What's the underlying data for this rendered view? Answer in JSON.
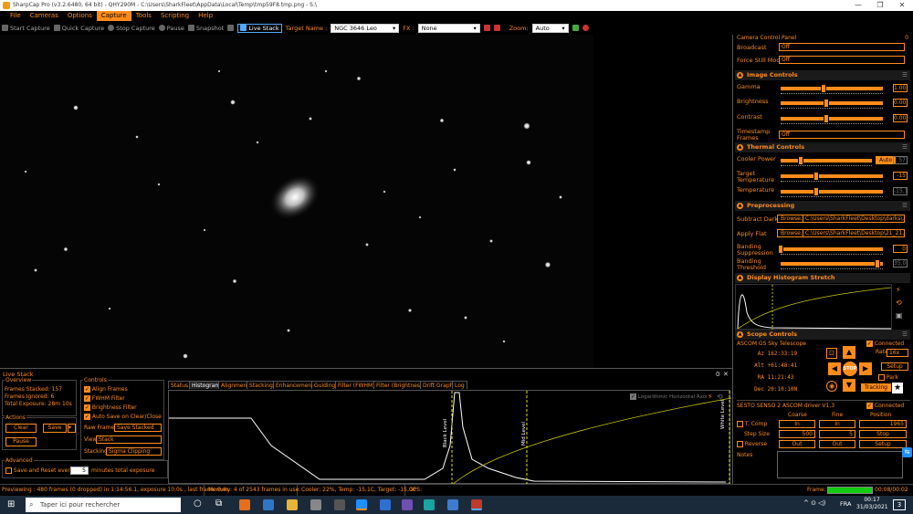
{
  "window": {
    "title": "SharpCap Pro (v3.2.6480, 64 bit) - QHY290M - C:\\Users\\SharkFleet\\AppData\\Local\\Temp\\tmp59F8.tmp.png - S:\\",
    "minimize": "—",
    "maximize": "❐",
    "close": "✕"
  },
  "menu": {
    "items": [
      "File",
      "Cameras",
      "Options",
      "Capture",
      "Tools",
      "Scripting",
      "Help"
    ],
    "active_index": 3
  },
  "toolbar": {
    "start_capture": "Start Capture",
    "quick_capture": "Quick Capture",
    "stop_capture": "Stop Capture",
    "pause": "Pause",
    "snapshot": "Snapshot",
    "live_stack": "Live Stack",
    "target_name_label": "Target Name :",
    "target_name_value": "NGC 3646 Leo",
    "fx_label": "FX :",
    "fx_value": "None",
    "zoom_label": "Zoom:",
    "zoom_value": "Auto"
  },
  "camera_panel": {
    "title": "Camera Control Panel",
    "pin": "0",
    "broadcast_label": "Broadcast",
    "broadcast_value": "Off",
    "force_still_label": "Force Still Mode",
    "force_still_value": "Off"
  },
  "image_controls": {
    "title": "Image Controls",
    "gamma_label": "Gamma",
    "gamma_value": "1.00",
    "gamma_level": 0.42,
    "brightness_label": "Brightness",
    "brightness_value": "0.00",
    "brightness_level": 0.45,
    "contrast_label": "Contrast",
    "contrast_value": "0.00",
    "contrast_level": 0.45,
    "timestamp_label": "Timestamp Frames",
    "timestamp_value": "Off"
  },
  "thermal": {
    "title": "Thermal Controls",
    "cooler_label": "Cooler Power",
    "cooler_auto": "Auto",
    "cooler_value": "57",
    "cooler_level": 0.22,
    "target_label": "Target Temperature",
    "target_value": "-15",
    "target_level": 0.35,
    "temp_label": "Temperature",
    "temp_value": "-15.1",
    "temp_level": 0.35
  },
  "preprocessing": {
    "title": "Preprocessing",
    "dark_label": "Subtract Dark",
    "dark_browse": "Browse...",
    "dark_path": "C:\\Users\\SharkFleet\\Desktop\\darks\\...",
    "flat_label": "Apply Flat",
    "flat_browse": "Browse...",
    "flat_path": "C:\\Users\\SharkFleet\\Desktop\\21_21...",
    "banding_supp_label": "Banding Suppression",
    "banding_supp_value": "0",
    "banding_supp_level": 0.0,
    "banding_thr_label": "Banding Threshold",
    "banding_thr_value": "35.0",
    "banding_thr_level": 0.95
  },
  "display_histogram": {
    "title": "Display Histogram Stretch"
  },
  "scope": {
    "title": "Scope Controls",
    "mount_name": "ASCOM GS Sky Telescope",
    "connected_label": "Connected",
    "az_label": "Az",
    "az_value": "162:33:19",
    "alt_label": "Alt",
    "alt_value": "+61:48:41",
    "ra_label": "RA",
    "ra_value": "11:21:43",
    "dec_label": "Dec",
    "dec_value": "20:10:10N",
    "rate_label": "Rate",
    "rate_value": "16x",
    "setup_label": "Setup",
    "park_label": "Park",
    "stop_label": "STOP",
    "tracking_label": "Tracking"
  },
  "focuser": {
    "name": "SESTO SENSO 2 ASCOM driver V1.3",
    "connected_label": "Connected",
    "coarse_label": "Coarse",
    "fine_label": "Fine",
    "position_label": "Position",
    "tcomp_label": "T. Comp",
    "in_label": "In",
    "position_value": "1965",
    "step_size_label": "Step Size",
    "coarse_step": "500",
    "fine_step": "5",
    "stop_label": "Stop",
    "reverse_label": "Reverse",
    "out_label": "Out",
    "setup_label": "Setup",
    "notes_label": "Notes"
  },
  "livestack": {
    "title": "Live Stack",
    "overview_label": "Overview",
    "frames_stacked": "Frames Stacked: 157",
    "frames_ignored": "Frames Ignored: 6",
    "total_exposure": "Total Exposure: 28m 10s",
    "actions_label": "Actions",
    "clear_label": "Clear",
    "save_label": "Save",
    "pause_label": "Pause",
    "advanced_label": "Advanced",
    "save_reset_label": "Save and Reset every",
    "save_reset_value": "5",
    "minutes_label": "minutes total exposure",
    "controls_label": "Controls",
    "align_frames": "Align Frames",
    "fwhm_filter": "FWHM Filter",
    "brightness_filter": "Brightness Filter",
    "autosave": "Auto Save on Clear/Close",
    "raw_frames_label": "Raw Frames",
    "raw_frames_value": "Save Stacked",
    "view_label": "View",
    "view_value": "Stack",
    "stacking_label": "Stacking",
    "stacking_value": "Sigma Clipping",
    "panel_pin": "0",
    "panel_close": "✕"
  },
  "tabs": [
    "Status",
    "Histogram",
    "Alignment",
    "Stacking",
    "Enhancement",
    "Guiding",
    "Filter (FWHM)",
    "Filter (Brightness)",
    "Drift Graph",
    "Log"
  ],
  "active_tab": 1,
  "histogram": {
    "logarithmic_label": "Logarithmic Horizontal Axis",
    "black_level_label": "Black Level",
    "mid_level_label": "Mid Level",
    "white_level_label": "White Level"
  },
  "status": {
    "previewing": "Previewing : 480 frames (0 dropped) in 1:14:56.1, exposure 10,0s , last frame 0,4s",
    "memory": "Memory: 4 of 2543 frames in use.",
    "cooler": "Cooler: 22%, Temp: -15,1C, Target: -15,0C",
    "gps": "GPS:",
    "frame_label": "Frame:",
    "frame_time": "00:08/00:02"
  },
  "taskbar": {
    "search_placeholder": "Taper ici pour rechercher",
    "language": "FRA",
    "time": "00:17",
    "date": "31/03/2021",
    "notifications": "3"
  },
  "colors": {
    "accent": "#ff8c1a",
    "background": "#000000",
    "taskbar": "#1b2a3a"
  }
}
